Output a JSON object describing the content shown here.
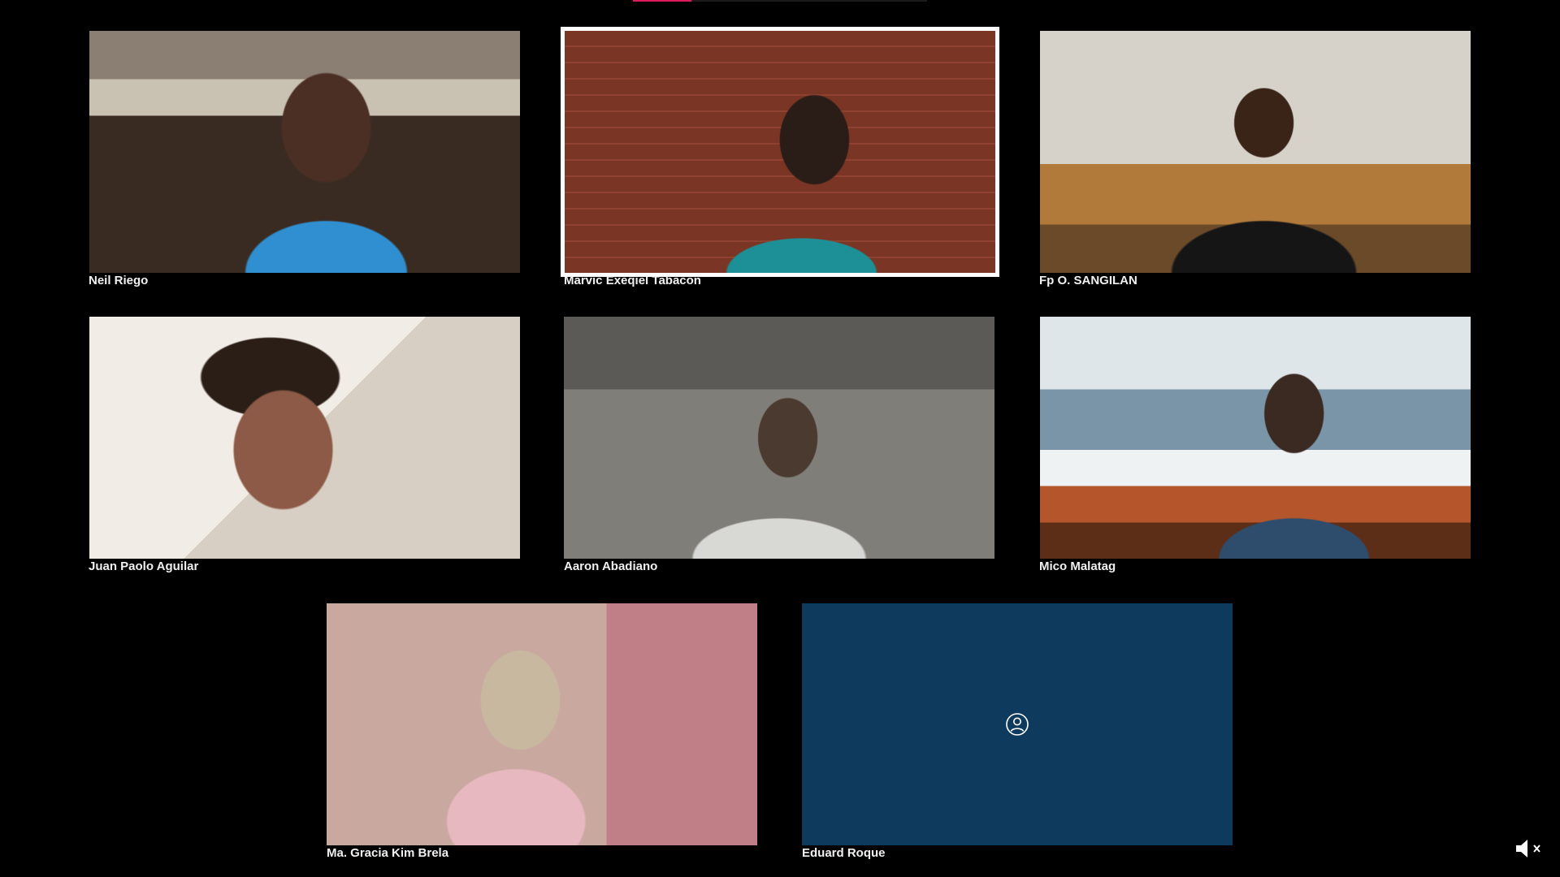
{
  "meeting": {
    "top_indicator_color": "#e01a5d",
    "participants": [
      {
        "name": "Neil Riego",
        "video": true,
        "speaking": false
      },
      {
        "name": "Marvic Exeqiel Tabacon",
        "video": true,
        "speaking": true
      },
      {
        "name": "Fp O. SANGILAN",
        "video": true,
        "speaking": false
      },
      {
        "name": "Juan Paolo Aguilar",
        "video": true,
        "speaking": false
      },
      {
        "name": "Aaron Abadiano",
        "video": true,
        "speaking": false
      },
      {
        "name": "Mico Malatag",
        "video": true,
        "speaking": false
      },
      {
        "name": "Ma. Gracia Kim Brela",
        "video": true,
        "speaking": false
      },
      {
        "name": "Eduard Roque",
        "video": false,
        "speaking": false,
        "placeholder_icon": "user-icon",
        "placeholder_color": "#0e3a5d"
      }
    ]
  },
  "controls": {
    "volume_icon": "speaker-muted-icon"
  }
}
